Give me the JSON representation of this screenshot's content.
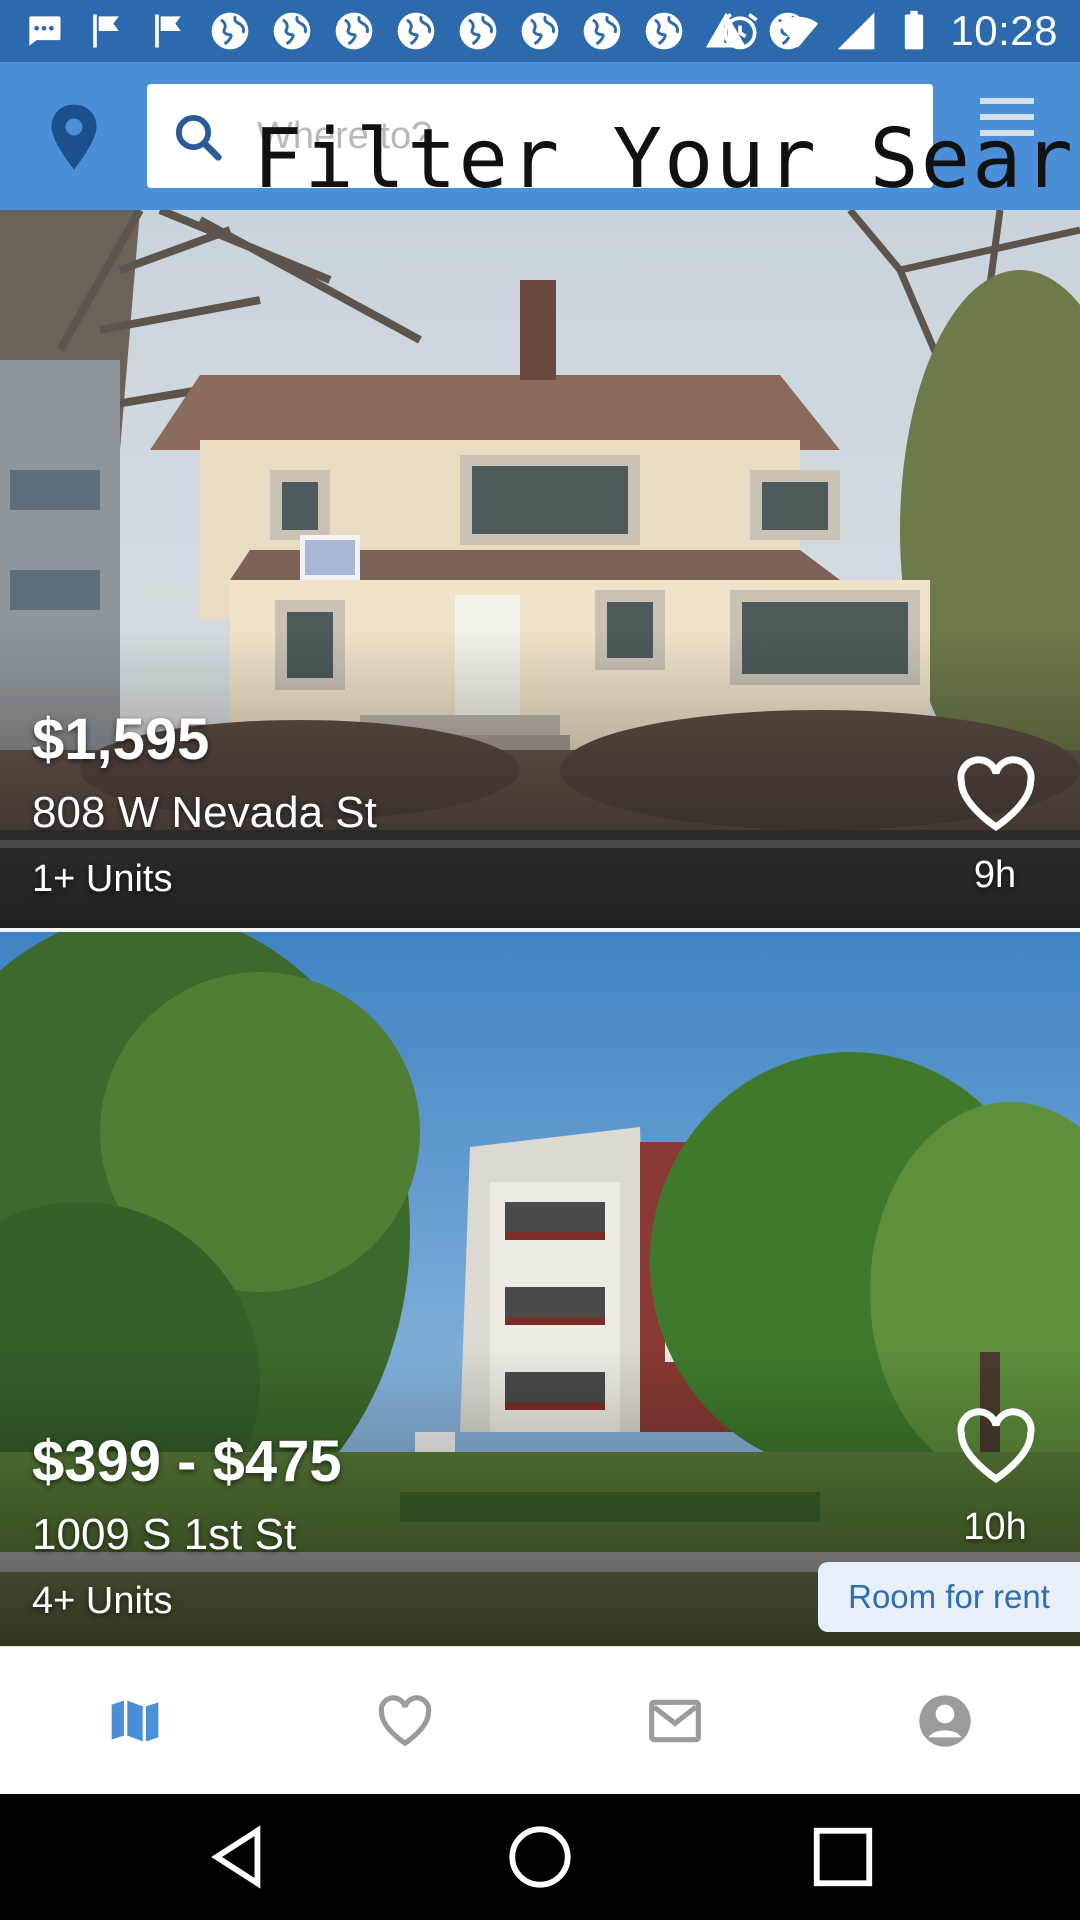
{
  "status_bar": {
    "time": "10:28",
    "left_icons": [
      "chat-bubble-icon",
      "flag-icon",
      "flag-icon",
      "globe-icon",
      "globe-icon",
      "globe-icon",
      "globe-icon",
      "globe-icon",
      "globe-icon",
      "globe-icon",
      "warning-icon",
      "globe-icon"
    ],
    "right_icons": [
      "alarm-icon",
      "wifi-icon",
      "signal-icon",
      "battery-icon"
    ]
  },
  "top_bar": {
    "search_placeholder": "Where to?",
    "overlay_text": "Filter Your Search"
  },
  "listings": [
    {
      "price": "$1,595",
      "address": "808 W Nevada St",
      "units": "1+ Units",
      "age": "9h"
    },
    {
      "price": "$399 - $475",
      "address": "1009 S 1st St",
      "units": "4+ Units",
      "age": "10h",
      "badge": "Room for rent"
    }
  ],
  "bottom_nav": [
    {
      "name": "map-icon",
      "active": true
    },
    {
      "name": "heart-icon",
      "active": false
    },
    {
      "name": "mail-icon",
      "active": false
    },
    {
      "name": "profile-icon",
      "active": false
    }
  ],
  "colors": {
    "status_bar": "#2d6aad",
    "top_bar": "#4a8fd8",
    "accent": "#4a8fd8",
    "nav_inactive": "#9b9b9b",
    "badge_text": "#2e6fb3",
    "badge_bg": "#e8eff8"
  }
}
